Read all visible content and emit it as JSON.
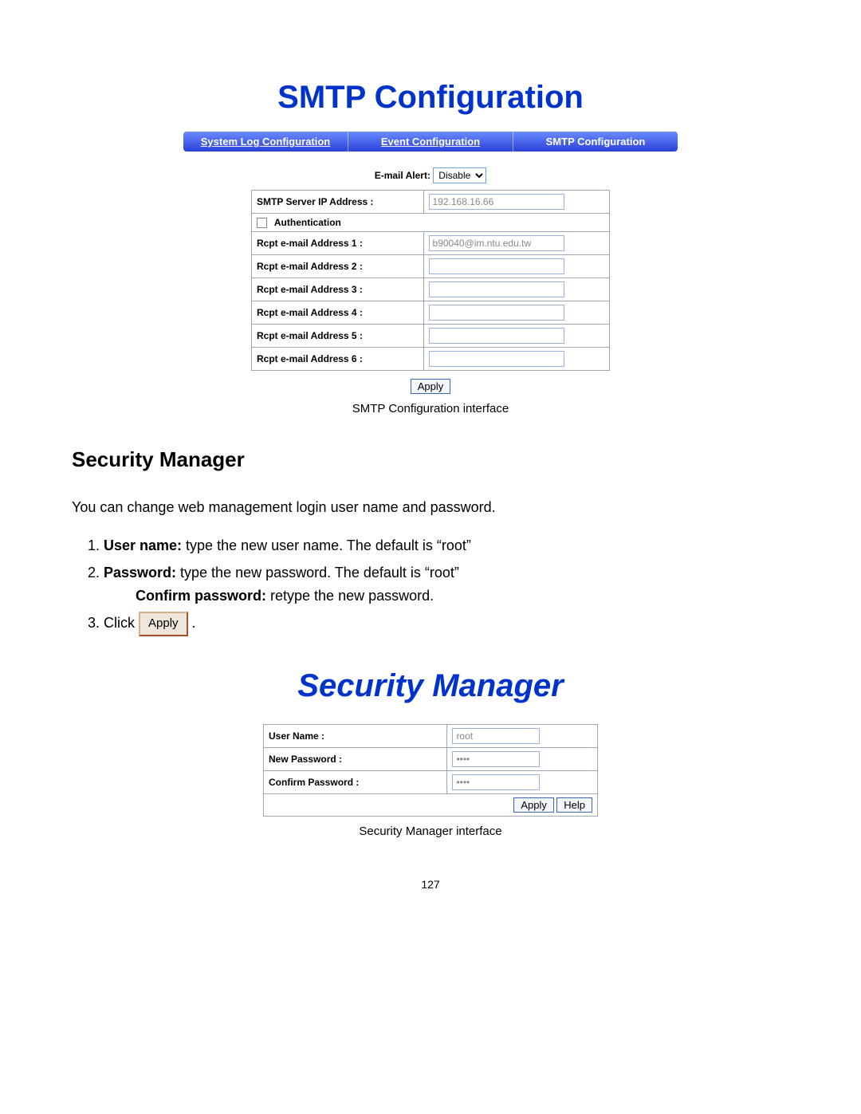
{
  "smtp": {
    "heading": "SMTP Configuration",
    "tabs": {
      "syslog": "System Log Configuration",
      "event": "Event Configuration",
      "smtp": "SMTP Configuration"
    },
    "email_alert_label": "E-mail Alert:",
    "email_alert_value": "Disable",
    "rows": {
      "server_ip_label": "SMTP Server IP Address :",
      "server_ip_value": "192.168.16.66",
      "auth_label": "Authentication",
      "r1_label": "Rcpt e-mail Address 1 :",
      "r1_value": "b90040@im.ntu.edu.tw",
      "r2_label": "Rcpt e-mail Address 2 :",
      "r3_label": "Rcpt e-mail Address 3 :",
      "r4_label": "Rcpt e-mail Address 4 :",
      "r5_label": "Rcpt e-mail Address 5 :",
      "r6_label": "Rcpt e-mail Address 6 :"
    },
    "apply_label": "Apply",
    "caption": "SMTP Configuration interface"
  },
  "body": {
    "section_heading": "Security Manager",
    "intro": "You can change web management login user name and password.",
    "item1_bold": "User name:",
    "item1_rest": " type the new user name. The default is “root”",
    "item2_bold": "Password:",
    "item2_rest": " type the new password. The default is “root”",
    "item2b_bold": "Confirm password:",
    "item2b_rest": " retype the new password.",
    "item3_prefix": "Click ",
    "item3_button": "Apply",
    "item3_suffix": " ."
  },
  "sec": {
    "heading": "Security Manager",
    "rows": {
      "user_label": "User Name :",
      "user_value": "root",
      "newpw_label": "New Password :",
      "newpw_value": "••••",
      "confpw_label": "Confirm Password :",
      "confpw_value": "••••"
    },
    "apply_label": "Apply",
    "help_label": "Help",
    "caption": "Security Manager interface"
  },
  "page_number": "127"
}
